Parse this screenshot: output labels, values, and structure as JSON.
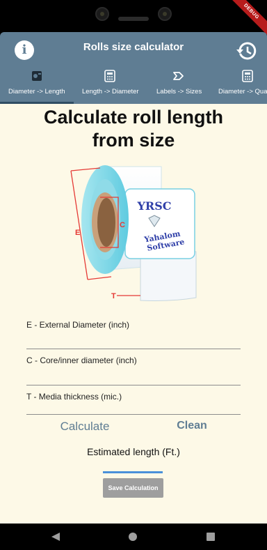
{
  "status": {
    "debug_label": "DEBUG"
  },
  "appbar": {
    "title": "Rolls size calculator",
    "info_icon": "info-icon",
    "history_icon": "history-icon"
  },
  "tabs": [
    {
      "label": "Diameter -> Length",
      "icon": "roll-icon",
      "selected": true
    },
    {
      "label": "Length -> Diameter",
      "icon": "calculator-icon",
      "selected": false
    },
    {
      "label": "Labels -> Sizes",
      "icon": "label-icon",
      "selected": false
    },
    {
      "label": "Diameter -> Quar",
      "icon": "calculator-icon",
      "selected": false
    }
  ],
  "main": {
    "title_line1": "Calculate roll length",
    "title_line2": "from size",
    "illustration": {
      "brand": "YRSC",
      "company_line1": "Yahalom",
      "company_line2": "Software",
      "label_e": "E",
      "label_c": "C",
      "label_t": "T"
    },
    "fields": [
      {
        "label": "E - External Diameter (inch)",
        "value": ""
      },
      {
        "label": "C - Core/inner diameter (inch)",
        "value": ""
      },
      {
        "label": "T - Media thickness (mic.)",
        "value": ""
      }
    ],
    "calculate_label": "Calculate",
    "clean_label": "Clean",
    "result_label": "Estimated length (Ft.)",
    "save_label": "Save Calculation"
  },
  "colors": {
    "appbar": "#5f7d93",
    "background": "#fdf9e7",
    "accent": "#5f7d93",
    "measure_lines": "#e53935"
  },
  "navbar": {
    "back_icon": "back-icon",
    "home_icon": "home-icon",
    "recents_icon": "recents-icon"
  }
}
